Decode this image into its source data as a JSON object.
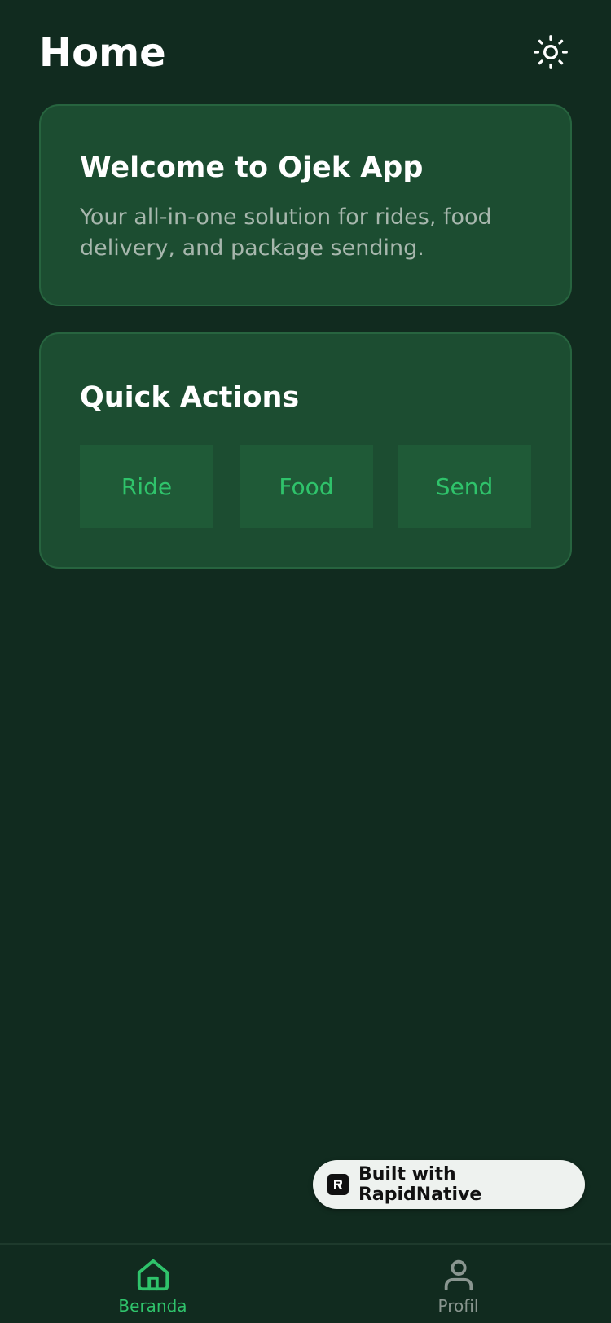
{
  "header": {
    "title": "Home",
    "theme_icon": "sun-icon"
  },
  "welcome_card": {
    "title": "Welcome to Ojek App",
    "description": "Your all-in-one solution for rides, food delivery, and package sending."
  },
  "quick_actions": {
    "title": "Quick Actions",
    "buttons": [
      {
        "label": "Ride"
      },
      {
        "label": "Food"
      },
      {
        "label": "Send"
      }
    ]
  },
  "badge": {
    "label": "Built with RapidNative",
    "icon": "rapidnative-logo-icon"
  },
  "tabbar": {
    "items": [
      {
        "label": "Beranda",
        "icon": "home-icon",
        "active": true
      },
      {
        "label": "Profil",
        "icon": "user-icon",
        "active": false
      }
    ]
  },
  "colors": {
    "background": "#112b1f",
    "card": "#1c4d31",
    "card_border": "#27643f",
    "accent": "#2fc36b",
    "muted_text": "#a7b7ad",
    "inactive_tab": "#8a9690"
  }
}
